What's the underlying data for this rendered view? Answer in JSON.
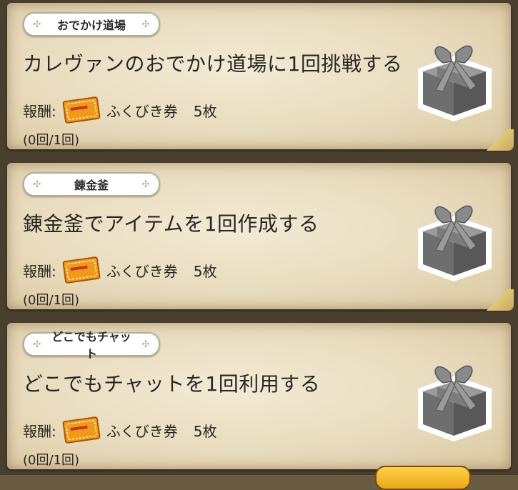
{
  "missions": [
    {
      "tag": "おでかけ道場",
      "title": "カレヴァンのおでかけ道場に1回挑戦する",
      "reward_label": "報酬:",
      "reward_item": "ふくびき券",
      "reward_count": "5枚",
      "progress": "(0回/1回)"
    },
    {
      "tag": "錬金釜",
      "title": "錬金釜でアイテムを1回作成する",
      "reward_label": "報酬:",
      "reward_item": "ふくびき券",
      "reward_count": "5枚",
      "progress": "(0回/1回)"
    },
    {
      "tag": "どこでもチャット",
      "title": "どこでもチャットを1回利用する",
      "reward_label": "報酬:",
      "reward_item": "ふくびき券",
      "reward_count": "5枚",
      "progress": "(0回/1回)"
    }
  ],
  "icons": {
    "reward_icon": "ticket-icon",
    "gift_icon": "gift-box-icon",
    "tag_deco_icon": "diamond-sparkle-icon"
  },
  "colors": {
    "parchment": "#efe4c8",
    "ticket_orange": "#f09a1a",
    "gift_gray": "#8a8a8a"
  }
}
